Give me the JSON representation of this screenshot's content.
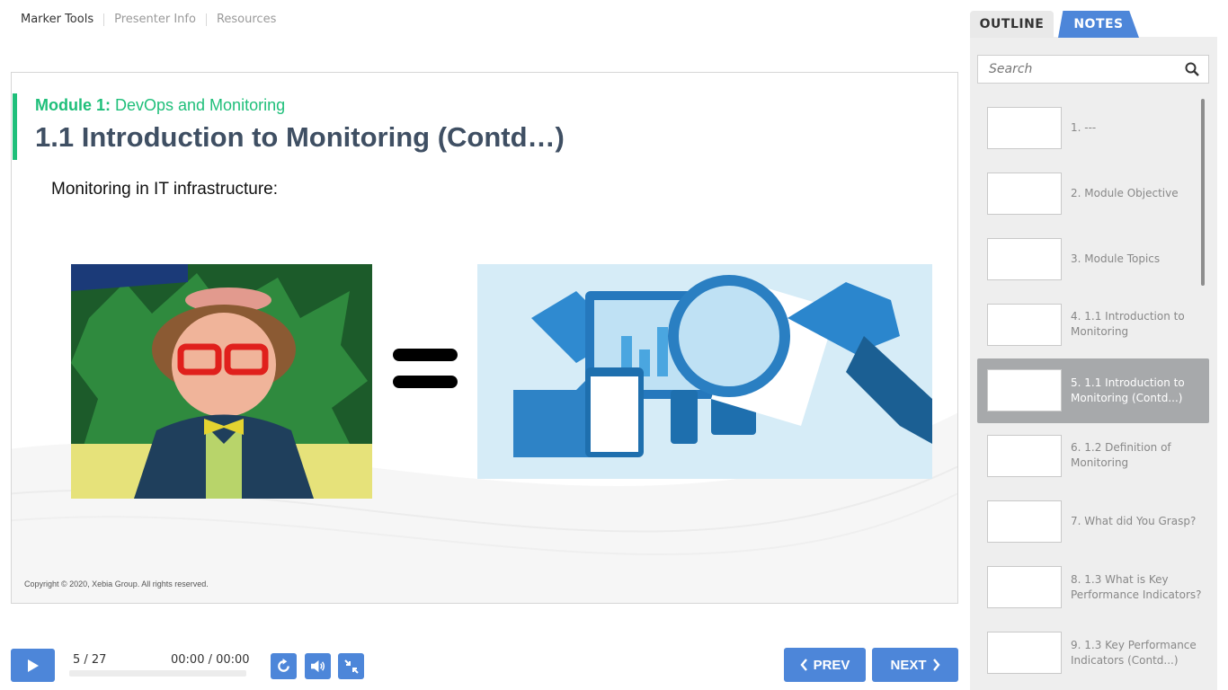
{
  "top_menu": {
    "items": [
      {
        "label": "Marker Tools"
      },
      {
        "label": "Presenter Info"
      },
      {
        "label": "Resources"
      }
    ]
  },
  "slide": {
    "module_prefix": "Module 1:",
    "module_name": " DevOps and Monitoring",
    "title": "1.1 Introduction to Monitoring (Contd…)",
    "subtitle": "Monitoring in IT infrastructure:",
    "copyright": "Copyright © 2020, Xebia Group. All rights reserved."
  },
  "player": {
    "slide_position": "5 / 27",
    "time": "00:00 / 00:00",
    "progress_fraction": 0,
    "prev_label": "PREV",
    "next_label": "NEXT"
  },
  "sidebar": {
    "tabs": [
      {
        "label": "OUTLINE"
      },
      {
        "label": "NOTES"
      }
    ],
    "search_placeholder": "Search",
    "items": [
      {
        "label": "1. ---"
      },
      {
        "label": "2. Module Objective"
      },
      {
        "label": "3. Module Topics"
      },
      {
        "label": "4. 1.1 Introduction to Monitoring"
      },
      {
        "label": "5. 1.1 Introduction to Monitoring (Contd...)",
        "active": true
      },
      {
        "label": "6. 1.2 Definition of Monitoring"
      },
      {
        "label": "7. What did You Grasp?"
      },
      {
        "label": "8. 1.3 What is Key Performance Indicators?"
      },
      {
        "label": "9. 1.3 Key Performance Indicators (Contd...)"
      }
    ]
  },
  "colors": {
    "accent_blue": "#4d86d9",
    "accent_green": "#1fbf7a",
    "title_text": "#3f4f63"
  }
}
